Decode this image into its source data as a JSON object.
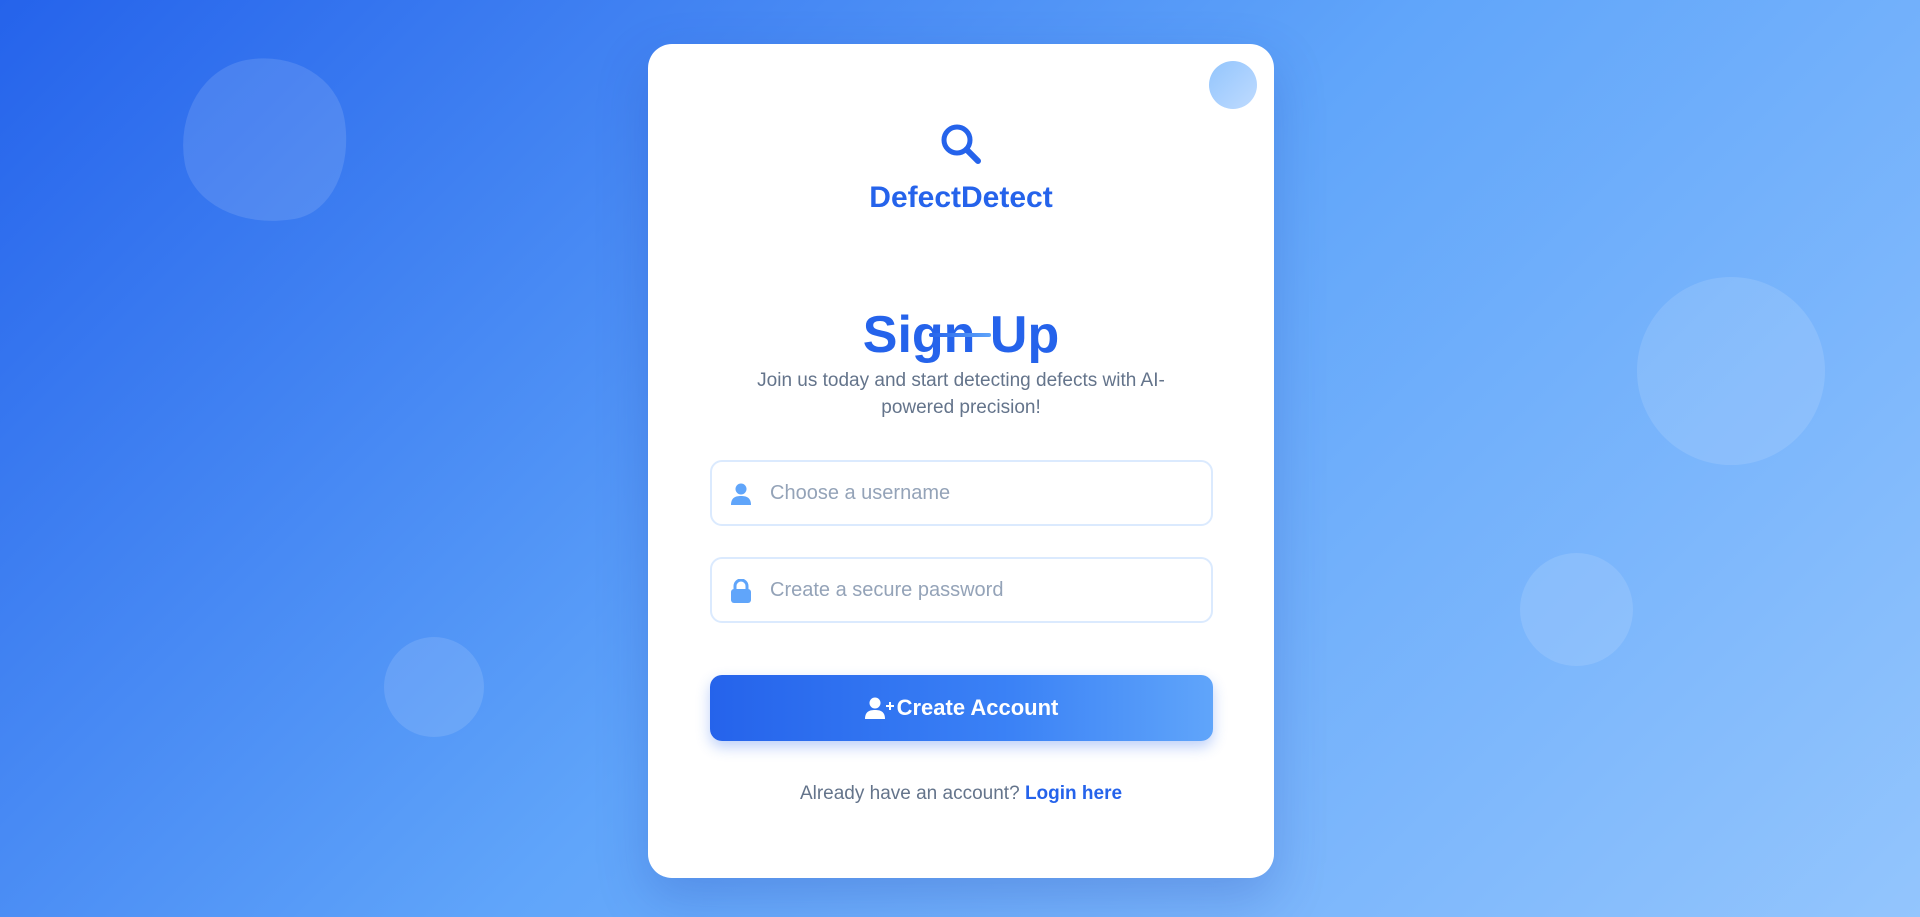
{
  "brand": {
    "name": "DefectDetect",
    "icon": "search-icon"
  },
  "form": {
    "title": "Sign Up",
    "subtitle": "Join us today and start detecting defects with AI-powered precision!",
    "username": {
      "placeholder": "Choose a username",
      "value": "",
      "icon": "user-icon"
    },
    "password": {
      "placeholder": "Create a secure password",
      "value": "",
      "icon": "lock-icon"
    },
    "submit_label": "Create Account",
    "submit_icon": "user-plus-icon"
  },
  "footer": {
    "prompt": "Already have an account?",
    "login_link": "Login here"
  },
  "colors": {
    "accent": "#2563eb",
    "accent_light": "#60a5fa",
    "text_muted": "#64748b"
  }
}
